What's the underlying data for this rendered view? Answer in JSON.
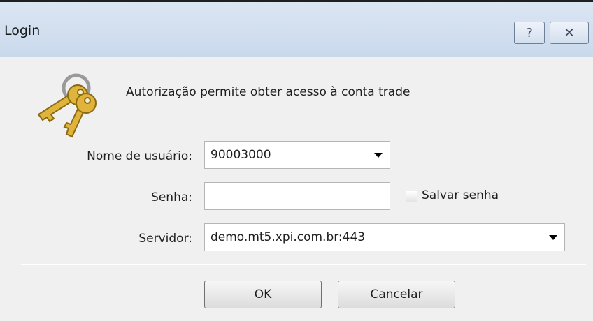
{
  "window": {
    "title": "Login",
    "help_button": "?",
    "close_button": "✕"
  },
  "dialog": {
    "prompt": "Autorização permite obter acesso à conta trade",
    "icon": "keys-icon",
    "fields": {
      "username": {
        "label": "Nome de usuário:",
        "value": "90003000"
      },
      "password": {
        "label": "Senha:",
        "value": ""
      },
      "save_password": {
        "label": "Salvar senha",
        "checked": false
      },
      "server": {
        "label": "Servidor:",
        "value": "demo.mt5.xpi.com.br:443"
      }
    },
    "buttons": {
      "ok": "OK",
      "cancel": "Cancelar"
    }
  },
  "colors": {
    "titlebar": "#c9d9ec",
    "dialog_bg": "#f0f0f0",
    "key_gold": "#e0b43a"
  }
}
